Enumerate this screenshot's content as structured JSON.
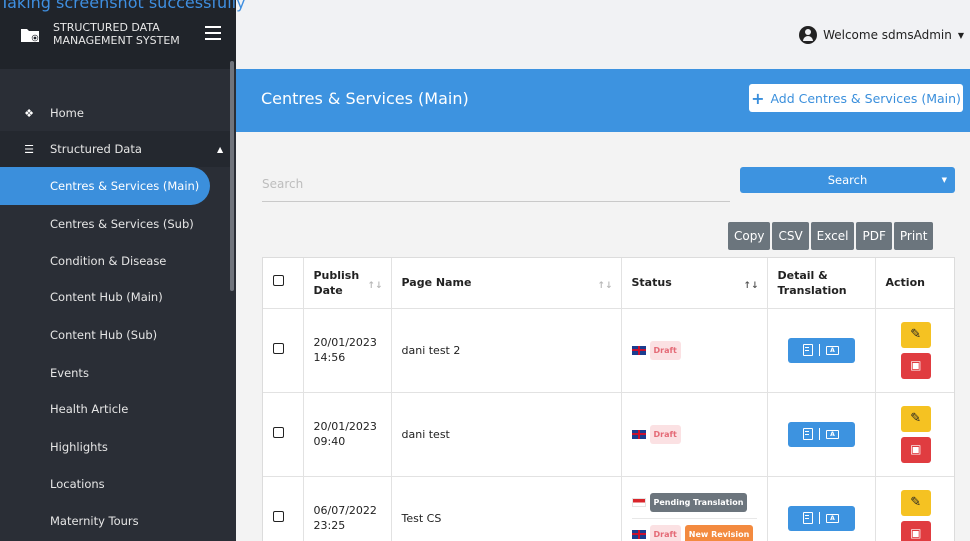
{
  "overlay": {
    "text": "Taking screenshot successfully"
  },
  "brand": {
    "title": "STRUCTURED DATA MANAGEMENT SYSTEM"
  },
  "user": {
    "welcome": "Welcome sdmsAdmin"
  },
  "sidebar": {
    "home": "Home",
    "structured_data": "Structured Data",
    "items": [
      "Centres & Services (Main)",
      "Centres & Services (Sub)",
      "Condition & Disease",
      "Content Hub (Main)",
      "Content Hub (Sub)",
      "Events",
      "Health Article",
      "Highlights",
      "Locations",
      "Maternity Tours"
    ]
  },
  "header": {
    "title": "Centres & Services (Main)",
    "add_label": "Add Centres & Services (Main)"
  },
  "search": {
    "placeholder": "Search",
    "button_label": "Search"
  },
  "export": {
    "copy": "Copy",
    "csv": "CSV",
    "excel": "Excel",
    "pdf": "PDF",
    "print": "Print"
  },
  "table": {
    "columns": {
      "publish_date": "Publish Date",
      "page_name": "Page Name",
      "status": "Status",
      "detail": "Detail & Translation",
      "action": "Action"
    },
    "rows": [
      {
        "date": "20/01/2023",
        "time": "14:56",
        "name": "dani test 2",
        "status": "Draft"
      },
      {
        "date": "20/01/2023",
        "time": "09:40",
        "name": "dani test",
        "status": "Draft"
      },
      {
        "date": "06/07/2022",
        "time": "23:25",
        "name": "Test CS",
        "pending": "Pending Translation",
        "status": "Draft",
        "revision": "New Revision"
      }
    ]
  },
  "colors": {
    "accent": "#3d93e0",
    "sidebar": "#2a2e36",
    "edit": "#f5c222",
    "delete": "#e03c40"
  }
}
